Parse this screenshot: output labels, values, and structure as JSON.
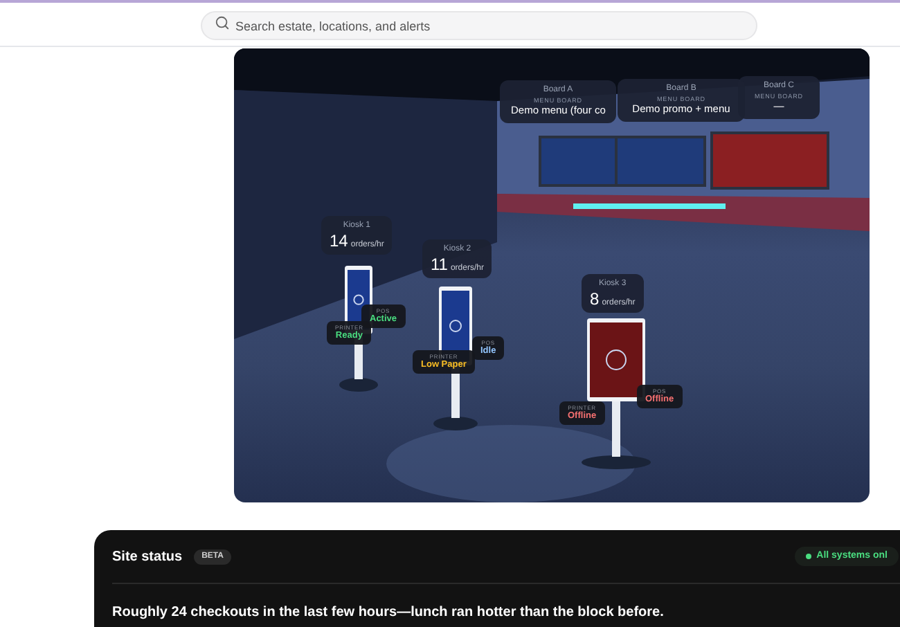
{
  "search": {
    "placeholder": "Search estate, locations, and alerts"
  },
  "scene": {
    "boards": [
      {
        "name": "Board A",
        "type": "MENU BOARD",
        "content": "Demo menu (four co",
        "color": "#1f3b7a"
      },
      {
        "name": "Board B",
        "type": "MENU BOARD",
        "content": "Demo promo + menu",
        "color": "#1f3b7a"
      },
      {
        "name": "Board C",
        "type": "MENU BOARD",
        "content": "—",
        "color": "#8b1f22"
      }
    ],
    "kiosks": [
      {
        "name": "Kiosk 1",
        "rate": "14",
        "unit": "orders/hr",
        "color": "#1b3a8f",
        "printer": {
          "label": "PRINTER",
          "value": "Ready",
          "color": "#4ade80"
        },
        "pos": {
          "label": "POS",
          "value": "Active",
          "color": "#4ade80"
        }
      },
      {
        "name": "Kiosk 2",
        "rate": "11",
        "unit": "orders/hr",
        "color": "#1b3a8f",
        "printer": {
          "label": "PRINTER",
          "value": "Low Paper",
          "color": "#fbbf24"
        },
        "pos": {
          "label": "POS",
          "value": "Idle",
          "color": "#93c5fd"
        }
      },
      {
        "name": "Kiosk 3",
        "rate": "8",
        "unit": "orders/hr",
        "color": "#6b1416",
        "printer": {
          "label": "PRINTER",
          "value": "Offline",
          "color": "#f87171"
        },
        "pos": {
          "label": "POS",
          "value": "Offline",
          "color": "#f87171"
        }
      }
    ]
  },
  "site_status": {
    "title": "Site status",
    "badge": "BETA",
    "status": "All systems onl",
    "summary": "Roughly 24 checkouts in the last few hours—lunch ran hotter than the block before."
  }
}
